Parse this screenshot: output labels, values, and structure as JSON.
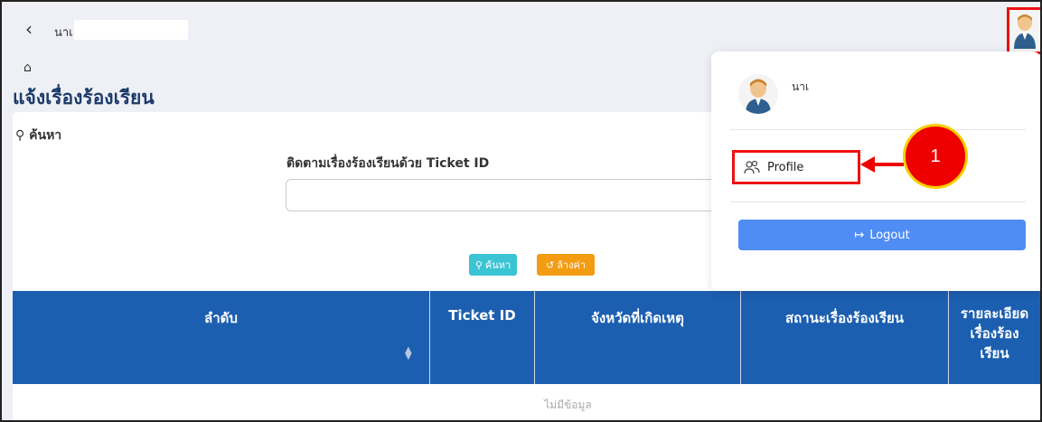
{
  "topbar": {
    "user_short": "นาเ",
    "back_icon": "chevron-left-icon"
  },
  "page": {
    "title": "แจ้งเรื่องร้องเรียน",
    "home_icon": "home-icon"
  },
  "search": {
    "heading": "ค้นหา",
    "ticket_label": "ติดตามเรื่องร้องเรียนด้วย Ticket ID",
    "ticket_value": "",
    "search_button": "ค้นหา",
    "reset_button": "ล้างค่า"
  },
  "table": {
    "headers": [
      "ลำดับ",
      "Ticket ID",
      "จังหวัดที่เกิดเหตุ",
      "สถานะเรื่องร้องเรียน",
      "รายละเอียดเรื่องร้องเรียน"
    ],
    "detail_header_lines": [
      "รายละเอียด",
      "เรื่องร้อง",
      "เรียน"
    ],
    "no_data": "ไม่มีข้อมูล"
  },
  "dropdown": {
    "user_name": "นาเ",
    "profile_label": "Profile",
    "logout_label": "Logout"
  },
  "annotation": {
    "callout_number": "1"
  },
  "colors": {
    "table_header": "#1c5fb0",
    "search_button": "#3bc4d4",
    "reset_button": "#f39c12",
    "logout_button": "#4f8df5",
    "highlight": "#e11111"
  }
}
